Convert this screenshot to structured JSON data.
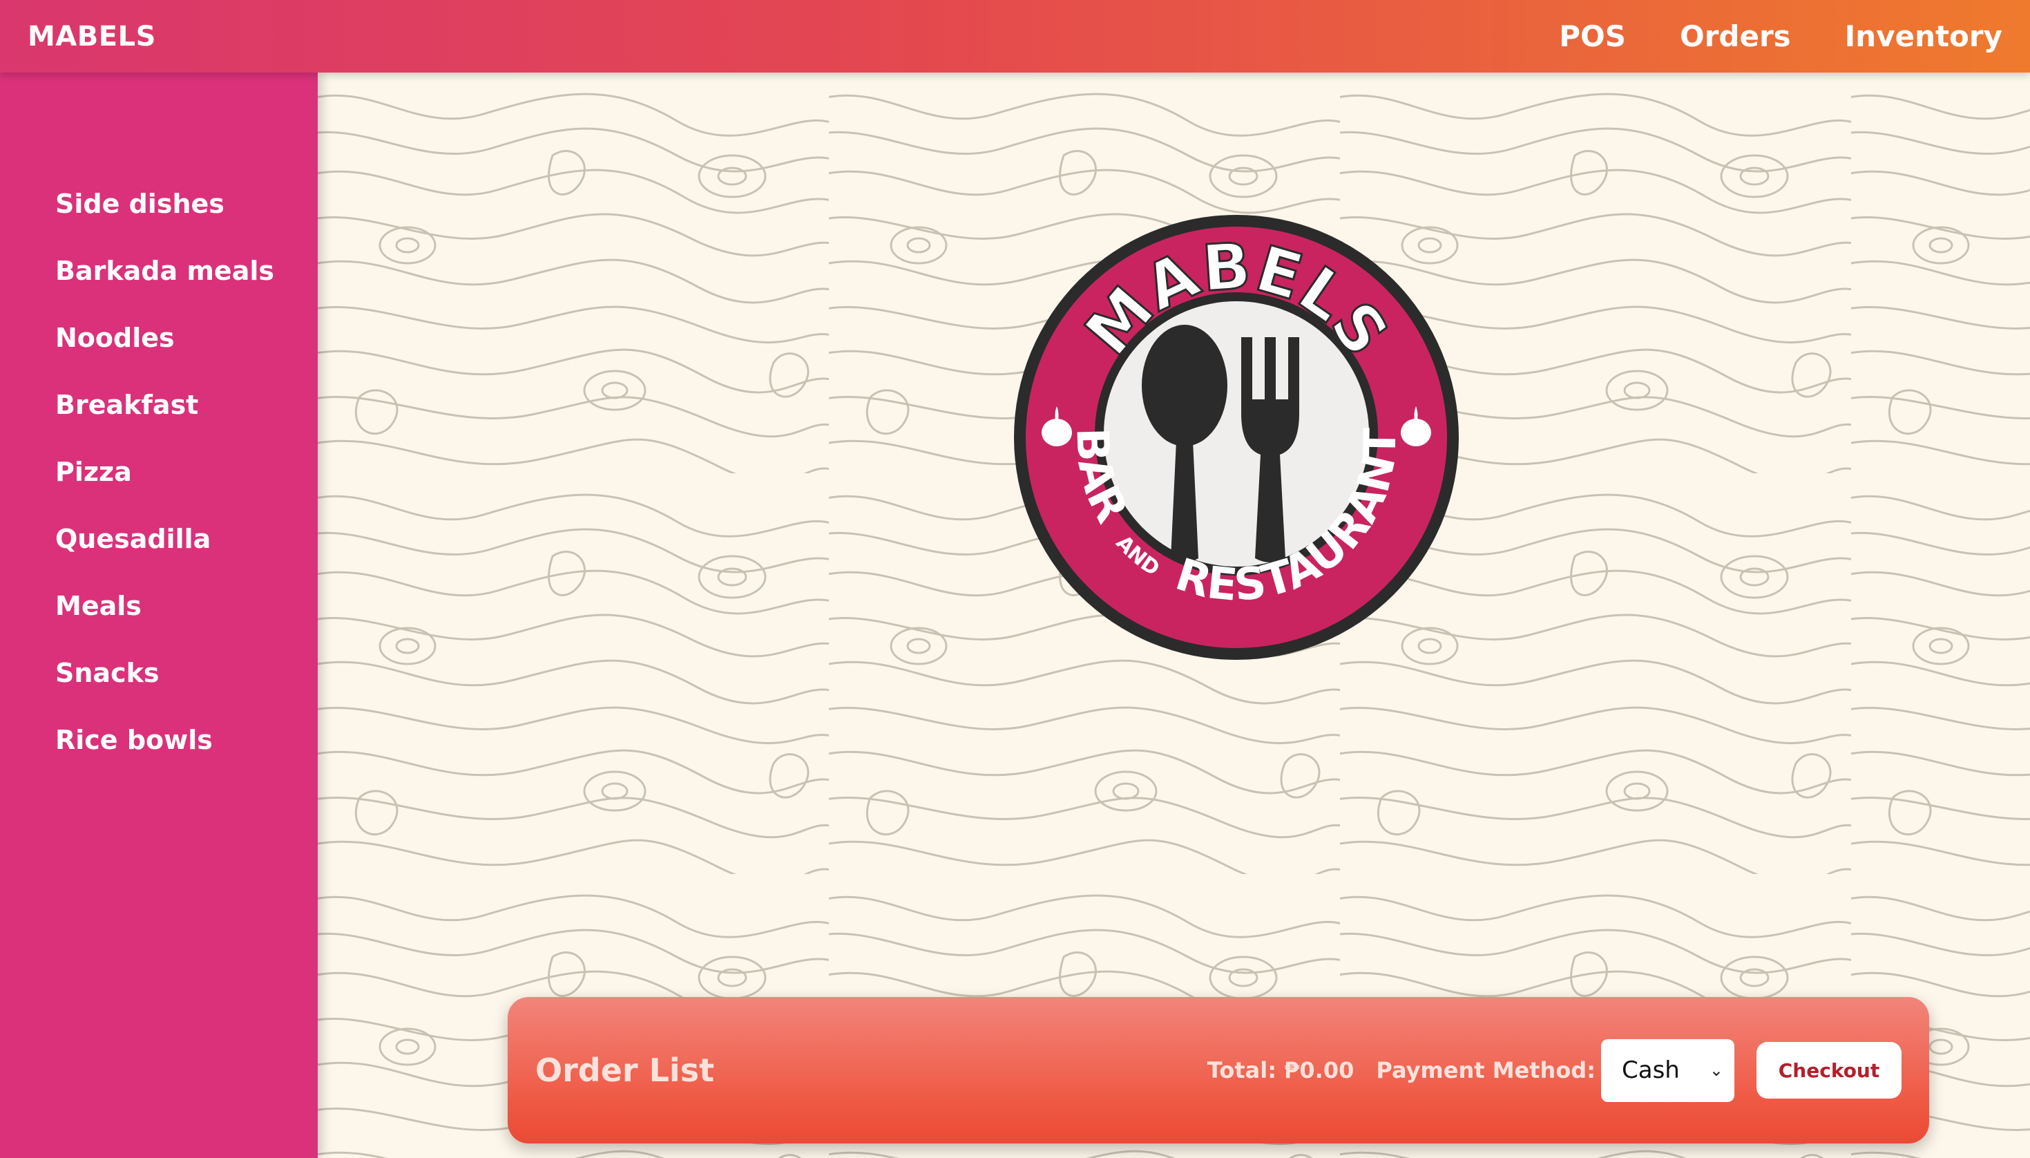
{
  "navbar": {
    "brand": "MABELS",
    "links": [
      "POS",
      "Orders",
      "Inventory"
    ]
  },
  "sidebar": {
    "categories": [
      "Side dishes",
      "Barkada meals",
      "Noodles",
      "Breakfast",
      "Pizza",
      "Quesadilla",
      "Meals",
      "Snacks",
      "Rice bowls"
    ]
  },
  "logo": {
    "top_text": "MABELS",
    "bottom_text_left": "BAR",
    "bottom_text_and": "AND",
    "bottom_text_right": "RESTAURANT",
    "icons": [
      "spoon-icon",
      "fork-icon",
      "garlic-icon"
    ]
  },
  "order_bar": {
    "title": "Order List",
    "total_label": "Total: ₱0.00",
    "payment_label": "Payment Method:",
    "payment_value": "Cash",
    "checkout_label": "Checkout"
  },
  "colors": {
    "navbar_start": "#d9376e",
    "navbar_end": "#ef7a2d",
    "sidebar": "#da317a",
    "background": "#fdf6ea",
    "order_bar": "#ef5a45",
    "logo_ring": "#c9245f",
    "logo_dark": "#2b2b2b"
  }
}
